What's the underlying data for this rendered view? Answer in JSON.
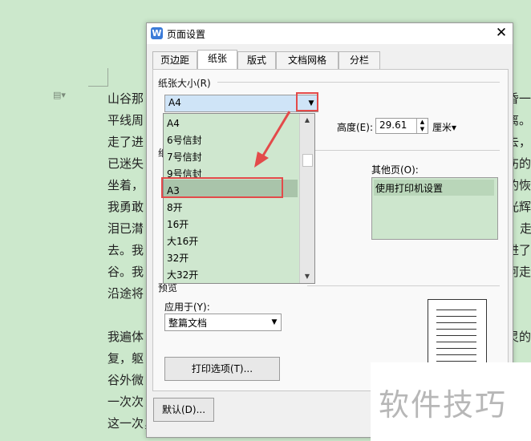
{
  "document": {
    "left_lines": [
      "山谷那",
      "平线周",
      "走了进",
      "已迷失",
      "坐着，",
      "我勇敢",
      "泪已潸",
      "去。我",
      "谷。我",
      "沿途将",
      "",
      "我遍体",
      "复，躯",
      "谷外微",
      "一次次",
      "这一次，我又进了山谷，我总看见天空中有明媚"
    ],
    "right_lines": [
      "昏一",
      "离。",
      "去，",
      "伤的",
      "的恢",
      "光辉",
      "走",
      "进了",
      "阿走",
      "",
      "",
      "灵的",
      "",
      "",
      "",
      ""
    ]
  },
  "dialog": {
    "title": "页面设置",
    "close_icon": "close-icon",
    "tabs": [
      "页边距",
      "纸张",
      "版式",
      "文档网格",
      "分栏"
    ],
    "active_tab": "纸张",
    "paper_size_label": "纸张大小(R)",
    "paper_size_value": "A4",
    "height_label": "高度(E):",
    "height_value": "29.61",
    "height_unit": "厘米",
    "paper_source_label": "纸",
    "other_pages_label": "其他页(O):",
    "other_pages_value": "使用打印机设置",
    "dropdown_items": [
      "A4",
      "6号信封",
      "7号信封",
      "9号信封",
      "A3",
      "8开",
      "16开",
      "大16开",
      "32开",
      "大32开"
    ],
    "dropdown_highlight": "A3",
    "preview_label": "预览",
    "apply_to_label": "应用于(Y):",
    "apply_to_value": "整篇文档",
    "print_options_button": "打印选项(T)...",
    "default_button": "默认(D)..."
  },
  "watermark": {
    "text": "软件技巧"
  },
  "colors": {
    "highlight_red": "#e34a4a",
    "doc_bg": "#cce8cc",
    "accent_blue": "#3b7bd8"
  }
}
